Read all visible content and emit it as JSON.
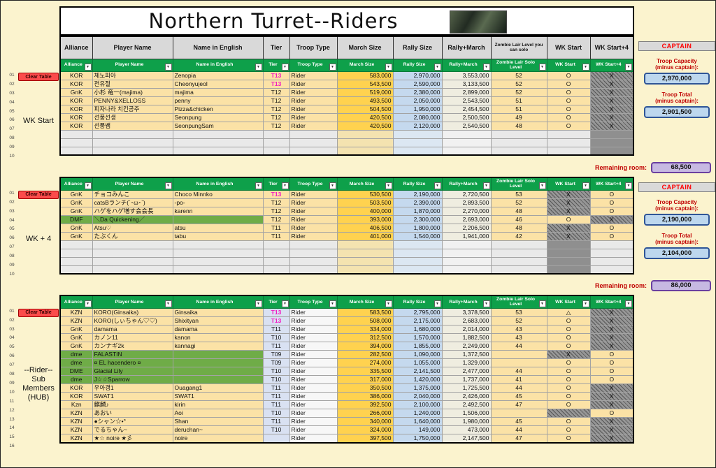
{
  "title": "Northern Turret--Riders",
  "columns": [
    "Alliance",
    "Player Name",
    "Name in English",
    "Tier",
    "Troop Type",
    "March Size",
    "Rally Size",
    "Rally+March",
    "Zombie Lair Level you can solo",
    "WK Start",
    "WK Start+4"
  ],
  "filter_columns": [
    "Alliance",
    "Player Name",
    "Name in English",
    "Tier",
    "Troop Type",
    "March Size",
    "Rally Size",
    "Rally+March",
    "Zombie Lair Solo Level",
    "WK Start",
    "WK Start+4"
  ],
  "tables": [
    {
      "id": "wk-start",
      "label_lines": [
        "WK Start"
      ],
      "clear_label": "Clear Table",
      "tier_blue": false,
      "panel": {
        "captain": "CAPTAIN",
        "capacity_title": "Troop Capacity",
        "total_title": "Troop Total",
        "minus": "(minus captain):",
        "capacity": "2,970,000",
        "total": "2,901,500",
        "remaining_label": "Remaining room:",
        "remaining": "68,500"
      },
      "rows": [
        {
          "n": "01",
          "cells": [
            "KOR",
            "체노피아",
            "Zenopia",
            "T13",
            "Rider",
            "583,000",
            "2,970,000",
            "3,553,000",
            "52",
            "O",
            "X"
          ],
          "dark": [
            false,
            true
          ]
        },
        {
          "n": "02",
          "cells": [
            "KOR",
            "전유절",
            "Cheonyujeol",
            "T13",
            "Rider",
            "543,500",
            "2,590,000",
            "3,133,500",
            "52",
            "O",
            "X"
          ],
          "dark": [
            false,
            true
          ]
        },
        {
          "n": "03",
          "cells": [
            "GnK",
            "小杉 竜一(majima)",
            "majima",
            "T12",
            "Rider",
            "519,000",
            "2,380,000",
            "2,899,000",
            "52",
            "O",
            "X"
          ],
          "dark": [
            false,
            true
          ]
        },
        {
          "n": "04",
          "cells": [
            "KOR",
            "PENNY&XELLOSS",
            "penny",
            "T12",
            "Rider",
            "493,500",
            "2,050,000",
            "2,543,500",
            "51",
            "O",
            "X"
          ],
          "dark": [
            false,
            true
          ]
        },
        {
          "n": "05",
          "cells": [
            "KOR",
            "피자나라 치킨공주",
            "Pizza&chicken",
            "T12",
            "Rider",
            "504,500",
            "1,950,000",
            "2,454,500",
            "51",
            "O",
            "X"
          ],
          "dark": [
            false,
            true
          ]
        },
        {
          "n": "06",
          "cells": [
            "KOR",
            "선풍선생",
            "Seonpung",
            "T12",
            "Rider",
            "420,500",
            "2,080,000",
            "2,500,500",
            "49",
            "O",
            "X"
          ],
          "dark": [
            false,
            true
          ]
        },
        {
          "n": "07",
          "cells": [
            "KOR",
            "선풍쌤",
            "SeonpungSam",
            "T12",
            "Rider",
            "420,500",
            "2,120,000",
            "2,540,500",
            "48",
            "O",
            "X"
          ],
          "dark": [
            false,
            true
          ]
        },
        {
          "n": "08",
          "cells": [
            "",
            "",
            "",
            "",
            "",
            "",
            "",
            "",
            "",
            "",
            ""
          ],
          "dark": [
            false,
            true
          ],
          "empty": true
        },
        {
          "n": "09",
          "cells": [
            "",
            "",
            "",
            "",
            "",
            "",
            "",
            "",
            "",
            "",
            ""
          ],
          "dark": [
            false,
            true
          ],
          "empty": true
        },
        {
          "n": "10",
          "cells": [
            "",
            "",
            "",
            "",
            "",
            "",
            "",
            "",
            "",
            "",
            ""
          ],
          "dark": [
            false,
            true
          ],
          "empty": true
        }
      ]
    },
    {
      "id": "wk-plus-4",
      "label_lines": [
        "WK + 4"
      ],
      "clear_label": "Clear Table",
      "tier_blue": false,
      "panel": {
        "captain": "CAPTAIN",
        "capacity_title": "Troop Capacity",
        "total_title": "Troop Total",
        "minus": "(minus captain):",
        "capacity": "2,190,000",
        "total": "2,104,000",
        "remaining_label": "Remaining room:",
        "remaining": "86,000"
      },
      "rows": [
        {
          "n": "01",
          "cells": [
            "GnK",
            "チョコみんこ",
            "Choco Minnko",
            "T13",
            "Rider",
            "530,500",
            "2,190,000",
            "2,720,500",
            "53",
            "X",
            "O"
          ],
          "dark": [
            true,
            false
          ]
        },
        {
          "n": "02",
          "cells": [
            "GnK",
            "catsBランチ(´･ω･`)",
            "-po-",
            "T12",
            "Rider",
            "503,500",
            "2,390,000",
            "2,893,500",
            "52",
            "X",
            "O"
          ],
          "dark": [
            true,
            false
          ]
        },
        {
          "n": "03",
          "cells": [
            "GnK",
            "ハゲをハゲ増す会会長",
            "karenn",
            "T12",
            "Rider",
            "400,000",
            "1,870,000",
            "2,270,000",
            "48",
            "X",
            "O"
          ],
          "dark": [
            true,
            false
          ]
        },
        {
          "n": "04",
          "cells": [
            "DMF",
            "＼Da Quickening／",
            "",
            "T12",
            "Rider",
            "393,000",
            "2,300,000",
            "2,693,000",
            "46",
            "O",
            "X"
          ],
          "dark": [
            false,
            true
          ],
          "green": true
        },
        {
          "n": "05",
          "cells": [
            "GnK",
            "Atsu♡",
            "atsu",
            "T11",
            "Rider",
            "406,500",
            "1,800,000",
            "2,206,500",
            "48",
            "X",
            "O"
          ],
          "dark": [
            true,
            false
          ]
        },
        {
          "n": "06",
          "cells": [
            "GnK",
            "たぶくん",
            "tabu",
            "T11",
            "Rider",
            "401,000",
            "1,540,000",
            "1,941,000",
            "42",
            "X",
            "O"
          ],
          "dark": [
            true,
            false
          ]
        },
        {
          "n": "07",
          "cells": [
            "",
            "",
            "",
            "",
            "",
            "",
            "",
            "",
            "",
            "",
            ""
          ],
          "dark": [
            true,
            false
          ],
          "empty": true
        },
        {
          "n": "08",
          "cells": [
            "",
            "",
            "",
            "",
            "",
            "",
            "",
            "",
            "",
            "",
            ""
          ],
          "dark": [
            true,
            false
          ],
          "empty": true
        },
        {
          "n": "09",
          "cells": [
            "",
            "",
            "",
            "",
            "",
            "",
            "",
            "",
            "",
            "",
            ""
          ],
          "dark": [
            true,
            false
          ],
          "empty": true
        },
        {
          "n": "10",
          "cells": [
            "",
            "",
            "",
            "",
            "",
            "",
            "",
            "",
            "",
            "",
            ""
          ],
          "dark": [
            true,
            false
          ],
          "empty": true
        }
      ]
    },
    {
      "id": "rider-sub-members-hub",
      "label_lines": [
        "--Rider--",
        "Sub",
        "Members",
        "(HUB)"
      ],
      "clear_label": "Clear Table",
      "tier_blue": true,
      "panel": null,
      "rows": [
        {
          "n": "01",
          "cells": [
            "KZN",
            "KORO(Ginsaika)",
            "Ginsaika",
            "T13",
            "Rider",
            "583,500",
            "2,795,000",
            "3,378,500",
            "53",
            "△",
            "X"
          ],
          "dark": [
            false,
            true
          ]
        },
        {
          "n": "02",
          "cells": [
            "KZN",
            "KORO(しぃちゃん♡♡)",
            "Shixityan",
            "T13",
            "Rider",
            "508,000",
            "2,175,000",
            "2,683,000",
            "52",
            "O",
            "X"
          ],
          "dark": [
            false,
            true
          ]
        },
        {
          "n": "03",
          "cells": [
            "GnK",
            "damama",
            "damama",
            "T11",
            "Rider",
            "334,000",
            "1,680,000",
            "2,014,000",
            "43",
            "O",
            "X"
          ],
          "dark": [
            false,
            true
          ]
        },
        {
          "n": "04",
          "cells": [
            "GnK",
            "カノン11",
            "kanon",
            "T10",
            "Rider",
            "312,500",
            "1,570,000",
            "1,882,500",
            "43",
            "O",
            "X"
          ],
          "dark": [
            false,
            true
          ]
        },
        {
          "n": "05",
          "cells": [
            "GnK",
            "カンナギ2k",
            "kannagi",
            "T11",
            "Rider",
            "394,000",
            "1,855,000",
            "2,249,000",
            "44",
            "O",
            "X"
          ],
          "dark": [
            false,
            true
          ]
        },
        {
          "n": "06",
          "cells": [
            "dme",
            "FALASTIN",
            "",
            "T09",
            "Rider",
            "282,500",
            "1,090,000",
            "1,372,500",
            "",
            "X",
            "O"
          ],
          "dark": [
            true,
            false
          ],
          "green": true
        },
        {
          "n": "07",
          "cells": [
            "dme",
            "¤ EL hacendero ¤",
            "",
            "T09",
            "Rider",
            "274,000",
            "1,055,000",
            "1,329,000",
            "",
            "O",
            "O"
          ],
          "dark": [
            false,
            false
          ],
          "green": true
        },
        {
          "n": "08",
          "cells": [
            "DME",
            "Glacial Lily",
            "",
            "T10",
            "Rider",
            "335,500",
            "2,141,500",
            "2,477,000",
            "44",
            "O",
            "O"
          ],
          "dark": [
            false,
            false
          ],
          "green": true
        },
        {
          "n": "09",
          "cells": [
            "dme",
            "J☆☆Sparrow",
            "",
            "T10",
            "Rider",
            "317,000",
            "1,420,000",
            "1,737,000",
            "41",
            "O",
            "O"
          ],
          "dark": [
            false,
            false
          ],
          "green": true
        },
        {
          "n": "10",
          "cells": [
            "KOR",
            "우아갱1",
            "Ouagang1",
            "T11",
            "Rider",
            "350,500",
            "1,375,000",
            "1,725,500",
            "44",
            "O",
            "X"
          ],
          "dark": [
            false,
            true
          ]
        },
        {
          "n": "11",
          "cells": [
            "KOR",
            "SWAT1",
            "SWAT1",
            "T11",
            "Rider",
            "386,000",
            "2,040,000",
            "2,426,000",
            "45",
            "O",
            "X"
          ],
          "dark": [
            false,
            true
          ]
        },
        {
          "n": "12",
          "cells": [
            "Kzn",
            "麒麟♪",
            "kirin",
            "T11",
            "Rider",
            "392,500",
            "2,100,000",
            "2,492,500",
            "47",
            "O",
            "X"
          ],
          "dark": [
            false,
            true
          ]
        },
        {
          "n": "13",
          "cells": [
            "KZN",
            "あおい",
            "Aoi",
            "T10",
            "Rider",
            "266,000",
            "1,240,000",
            "1,506,000",
            "",
            "",
            "O"
          ],
          "dark": [
            true,
            false
          ]
        },
        {
          "n": "14",
          "cells": [
            "KZN",
            "●シャン☆•°",
            "Shan",
            "T11",
            "Rider",
            "340,000",
            "1,640,000",
            "1,980,000",
            "45",
            "O",
            "X"
          ],
          "dark": [
            false,
            true
          ]
        },
        {
          "n": "15",
          "cells": [
            "KZN",
            "でるちゃん~",
            "deruchan~",
            "T10",
            "Rider",
            "324,000",
            "149,000",
            "473,000",
            "44",
            "O",
            "X"
          ],
          "dark": [
            false,
            true
          ]
        },
        {
          "n": "16",
          "cells": [
            "KZN",
            "★☆ noire ★彡",
            "noire",
            "",
            "Rider",
            "397,500",
            "1,750,000",
            "2,147,500",
            "47",
            "O",
            "X"
          ],
          "dark": [
            false,
            true
          ]
        }
      ]
    }
  ]
}
